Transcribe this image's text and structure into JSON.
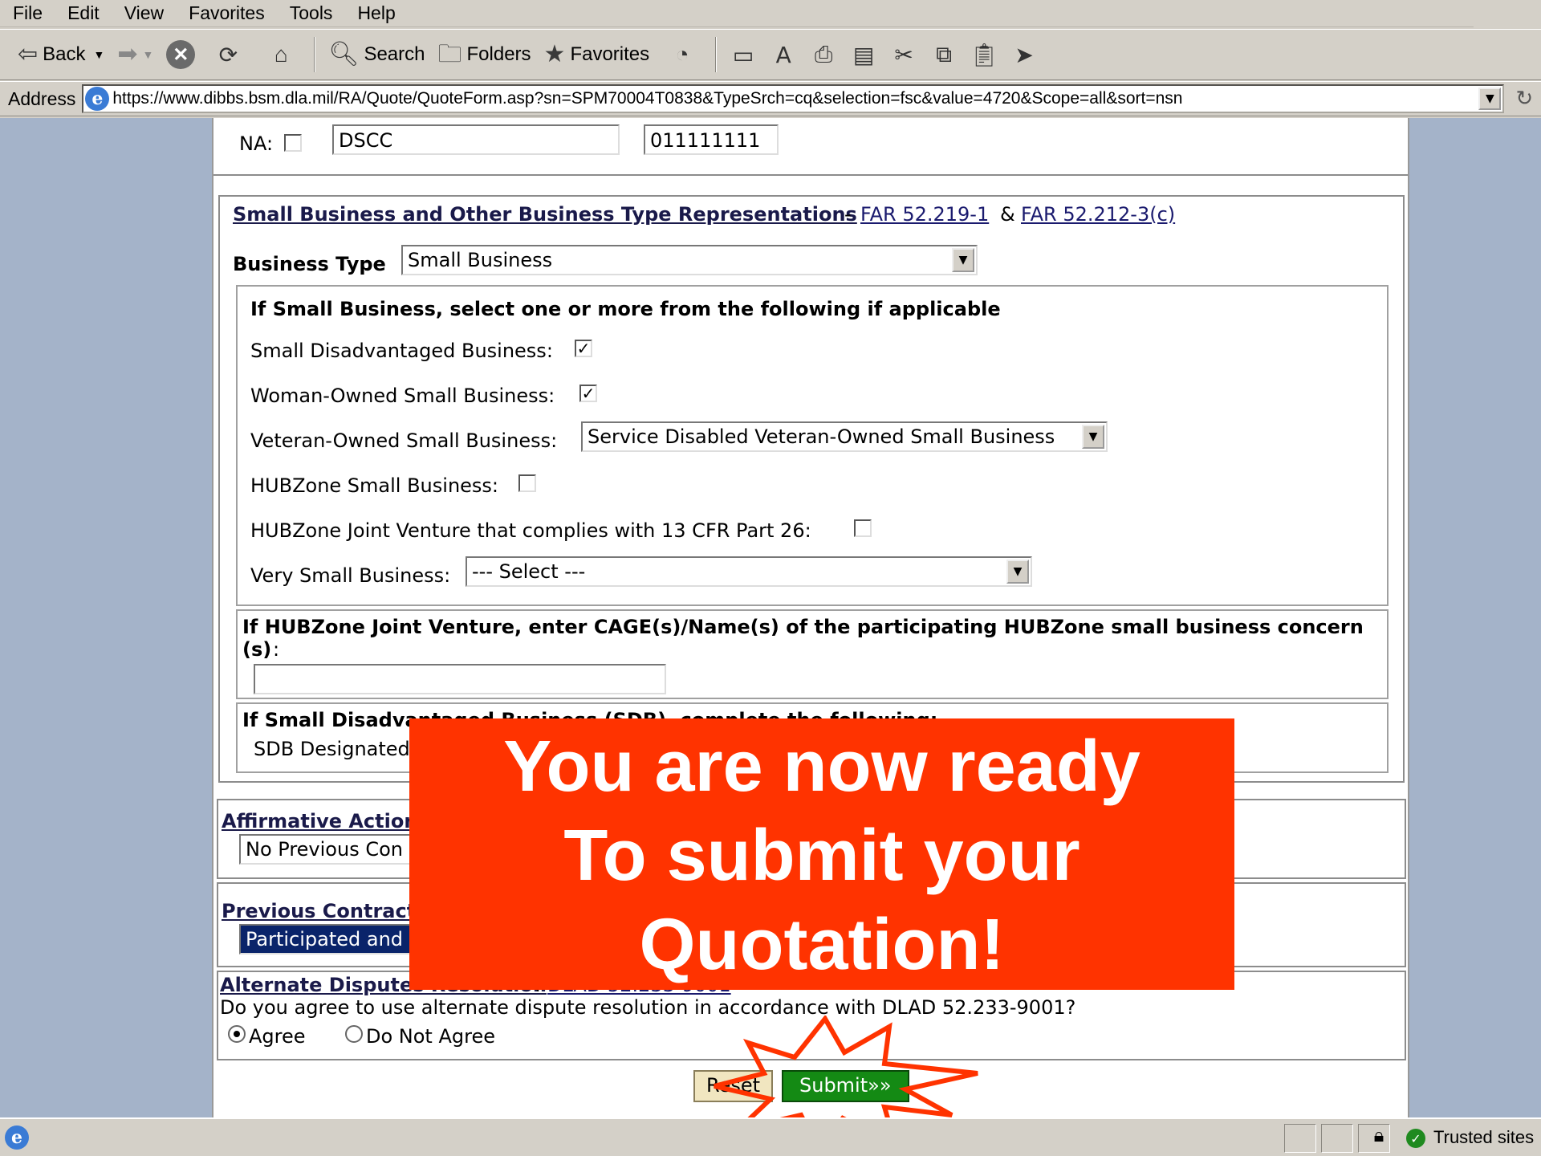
{
  "menu": [
    "File",
    "Edit",
    "View",
    "Favorites",
    "Tools",
    "Help"
  ],
  "toolbar": {
    "back_label": "Back",
    "search_label": "Search",
    "folders_label": "Folders",
    "favorites_label": "Favorites"
  },
  "address": {
    "label": "Address",
    "url": "https://www.dibbs.bsm.dla.mil/RA/Quote/QuoteForm.asp?sn=SPM70004T0838&TypeSrch=cq&selection=fsc&value=4720&Scope=all&sort=nsn"
  },
  "top_row": {
    "na_label": "NA:",
    "field1_value": "DSCC",
    "field2_value": "011111111"
  },
  "business_section": {
    "title": "Small Business and Other Business Type Representations",
    "dash": "-",
    "far1": "FAR 52.219-1",
    "amp": "&",
    "far2": "FAR 52.212-3(c)",
    "type_label": "Business Type",
    "type_colon": ":",
    "type_value": "Small Business",
    "sub_heading": "If Small Business, select one or more from the following if applicable",
    "sub_colon": ":",
    "sdb_label": "Small Disadvantaged Business:",
    "sdb_checked": true,
    "wosb_label": "Woman-Owned Small Business:",
    "wosb_checked": true,
    "vosb_label": "Veteran-Owned Small Business:",
    "vosb_value": "Service Disabled Veteran-Owned Small Business",
    "hub_label": "HUBZone Small Business:",
    "hub_checked": false,
    "hubjv_label": "HUBZone Joint Venture that complies with 13 CFR Part 26:",
    "hubjv_checked": false,
    "vsb_label": "Very Small Business:",
    "vsb_value": "--- Select ---"
  },
  "hubzone_jv": {
    "line1": "If HUBZone Joint Venture, enter CAGE(s)/Name(s) of the participating HUBZone small business concern",
    "line2": "(s)",
    "colon": ":",
    "value": ""
  },
  "sdb_section": {
    "heading": "If Small Disadvantaged Business (SDB), complete the following:",
    "designated": "SDB Designated"
  },
  "affirmative": {
    "title": "Affirmative Action",
    "value": "No Previous Con"
  },
  "previous": {
    "title": "Previous Contract",
    "value": "Participated and"
  },
  "adr": {
    "title": "Alternate Disputes Resolution",
    "colon": ":",
    "link": "DLAD 52.233-9001",
    "question": "Do you agree to use alternate dispute resolution in accordance with DLAD 52.233-9001?",
    "agree": "Agree",
    "disagree": "Do Not Agree",
    "selected": "Agree"
  },
  "buttons": {
    "reset": "Reset",
    "submit": "Submit»»"
  },
  "callout": {
    "line1": "You are now ready",
    "line2": "To submit your",
    "line3": "Quotation!",
    "color": "#ff3300"
  },
  "status": {
    "zone": "Trusted sites"
  },
  "colors": {
    "page_bg": "#a4b3c9",
    "chrome": "#d4d0c8",
    "submit_green": "#148a14"
  }
}
